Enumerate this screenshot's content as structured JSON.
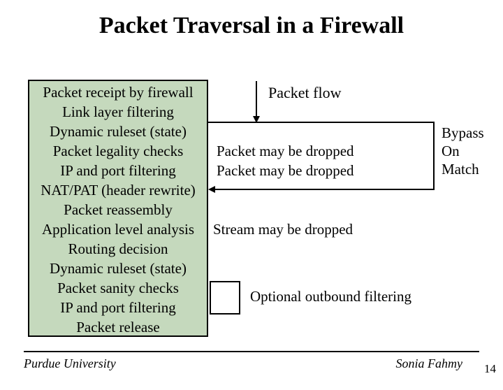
{
  "title": "Packet Traversal in a Firewall",
  "steps": [
    "Packet receipt by firewall",
    "Link layer filtering",
    "Dynamic ruleset (state)",
    "Packet legality checks",
    "IP and port filtering",
    "NAT/PAT (header rewrite)",
    "Packet reassembly",
    "Application level analysis",
    "Routing decision",
    "Dynamic ruleset (state)",
    "Packet sanity checks",
    "IP and port filtering",
    "Packet release"
  ],
  "labels": {
    "packet_flow": "Packet flow",
    "drop1": "Packet may be dropped",
    "drop2": "Packet may be dropped",
    "drop3": "Stream may be dropped",
    "bypass_line1": "Bypass",
    "bypass_line2": "On",
    "bypass_line3": "Match",
    "outbound": "Optional outbound filtering"
  },
  "footer": {
    "left": "Purdue University",
    "right": "Sonia Fahmy",
    "page": "14"
  }
}
